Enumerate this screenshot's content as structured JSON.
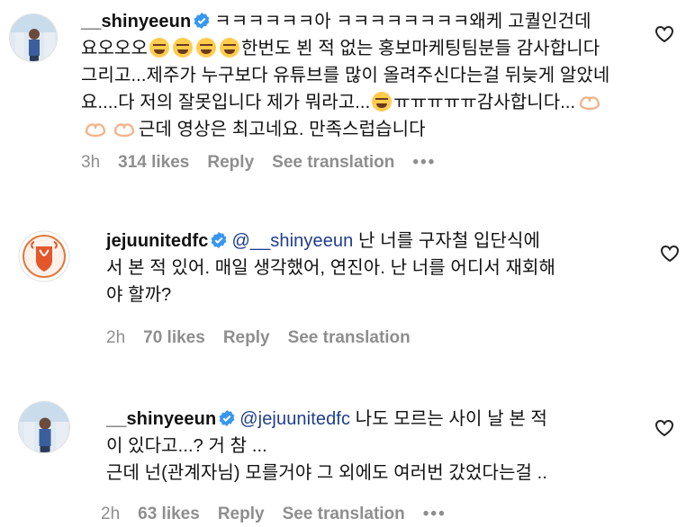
{
  "comments": [
    {
      "username": "__shinyeeun",
      "text_parts": [
        "ㅋㅋㅋㅋㅋㅋ아 ㅋㅋㅋㅋㅋㅋㅋㅋ왜케 고퀄인건데",
        "요오오오",
        "한번도 뵌 적 없는 홍보마케팅팀분들 감사합니다",
        "그리고...제주가 누구보다 유튜브를 많이 올려주신다는걸 뒤늦게 알았네",
        "요....다 저의 잘못입니다 제가 뭐라고...",
        "ㅠㅠㅠㅠㅠ감사합니다...",
        "근데 영상은 최고네요. 만족스럽습니다"
      ],
      "time": "3h",
      "likes": "314 likes",
      "reply": "Reply",
      "translate": "See translation",
      "more": "•••"
    },
    {
      "username": "jejuunitedfc",
      "mention": "@__shinyeeun",
      "text_parts": [
        " 난 너를 구자철 입단식에",
        "서 본 적 있어. 매일 생각했어, 연진아. 난 너를 어디서 재회해",
        "야 할까?"
      ],
      "time": "2h",
      "likes": "70 likes",
      "reply": "Reply",
      "translate": "See translation"
    },
    {
      "username": "__shinyeeun",
      "mention": "@jejuunitedfc",
      "text_parts": [
        " 나도 모르는 사이 날 본 적",
        "이 있다고...? 거 참 ...",
        "근데 넌(관계자님) 모를거야 그 외에도 여러번 갔었다는걸 .."
      ],
      "time": "2h",
      "likes": "63 likes",
      "reply": "Reply",
      "translate": "See translation",
      "more": "•••"
    }
  ],
  "icons": {
    "verified": "verified-badge-icon",
    "heart": "heart-outline-icon",
    "crying_emoji": "loudly-crying-face-emoji",
    "heart_hands": "heart-hands-emoji"
  },
  "colors": {
    "verified": "#3897f0",
    "meta": "#8e8e8e",
    "mention": "#1f3d8f"
  }
}
